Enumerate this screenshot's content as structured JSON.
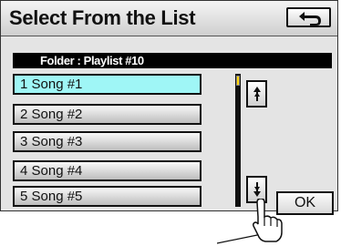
{
  "title": "Select From the List",
  "folder_label": "Folder : Playlist #10",
  "songs": [
    {
      "label": "1  Song #1",
      "selected": true
    },
    {
      "label": "2  Song #2",
      "selected": false
    },
    {
      "label": "3  Song #3",
      "selected": false
    },
    {
      "label": "4  Song #4",
      "selected": false
    },
    {
      "label": "5  Song #5",
      "selected": false
    }
  ],
  "ok_label": "OK",
  "icons": {
    "back": "back-arrow-icon",
    "scroll_up": "scroll-up-arrow-icon",
    "scroll_down": "scroll-down-arrow-icon",
    "pointer": "pointing-hand-icon"
  },
  "colors": {
    "selected_row": "#9ff6f6",
    "scroll_thumb": "#ffd200",
    "folder_bar": "#000000"
  },
  "scroll_position": 0.0
}
